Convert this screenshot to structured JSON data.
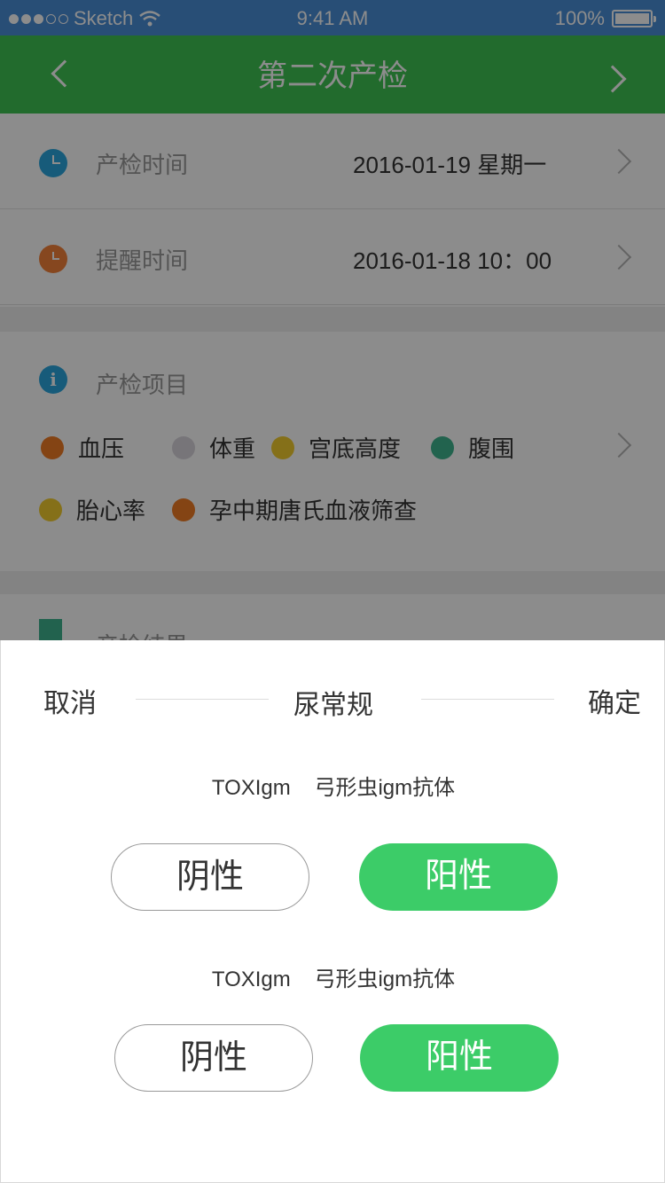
{
  "status_bar": {
    "carrier": "Sketch",
    "time": "9:41 AM",
    "battery": "100%"
  },
  "nav": {
    "title": "第二次产检"
  },
  "schedule": {
    "exam_time_label": "产检时间",
    "exam_time_value": "2016-01-19 星期一",
    "reminder_label": "提醒时间",
    "reminder_value": "2016-01-18 10：00"
  },
  "items": {
    "label": "产检项目",
    "chips": [
      {
        "label": "血压",
        "color": "#f07d25"
      },
      {
        "label": "体重",
        "color": "#d9d6dc"
      },
      {
        "label": "宫底高度",
        "color": "#f3cd2e"
      },
      {
        "label": "腹围",
        "color": "#3fb48f"
      },
      {
        "label": "胎心率",
        "color": "#f3cd2e"
      },
      {
        "label": "孕中期唐氏血液筛查",
        "color": "#f07d25"
      }
    ]
  },
  "results_peek": {
    "label": "产检结果"
  },
  "sheet": {
    "cancel": "取消",
    "title": "尿常规",
    "confirm": "确定",
    "tests": [
      {
        "name": "TOXIgm",
        "desc": "弓形虫igm抗体",
        "negative": "阴性",
        "positive": "阳性",
        "selected": "positive"
      },
      {
        "name": "TOXIgm",
        "desc": "弓形虫igm抗体",
        "negative": "阴性",
        "positive": "阳性",
        "selected": "positive"
      }
    ]
  },
  "colors": {
    "nav_green": "#3ec353",
    "status_blue": "#4a8fd8",
    "positive_green": "#3ccc68"
  }
}
